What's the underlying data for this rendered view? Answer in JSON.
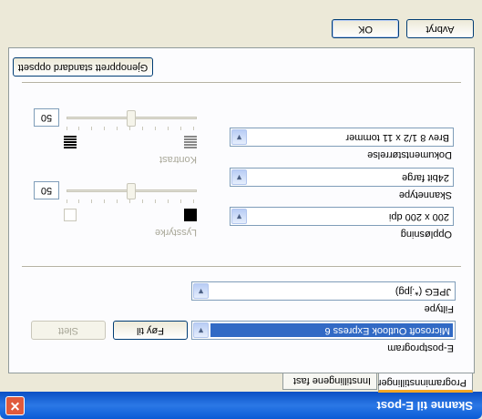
{
  "window": {
    "title": "Skanne til E-post"
  },
  "tabs": [
    {
      "label": "Programinnstillinger",
      "active": true
    },
    {
      "label": "Innstillingene fast",
      "active": false
    }
  ],
  "email_program": {
    "label": "E-postprogram",
    "value": "Microsoft Outlook Express 6",
    "add_button": "Føy til",
    "delete_button": "Slett"
  },
  "file_type": {
    "label": "Filtype",
    "value": "JPEG (*.jpg)"
  },
  "resolution": {
    "label": "Oppløsning",
    "value": "200 x 200 dpi"
  },
  "scan_type": {
    "label": "Skannetype",
    "value": "24bit farge"
  },
  "document_size": {
    "label": "Dokumentstørrelse",
    "value": "Brev 8 1/2 x 11 tommer"
  },
  "brightness": {
    "label": "Lysstyrke",
    "value": "50"
  },
  "contrast": {
    "label": "Kontrast",
    "value": "50"
  },
  "restore_defaults_button": "Gjenopprett standard oppsett",
  "footer": {
    "ok": "OK",
    "cancel": "Avbryt"
  }
}
